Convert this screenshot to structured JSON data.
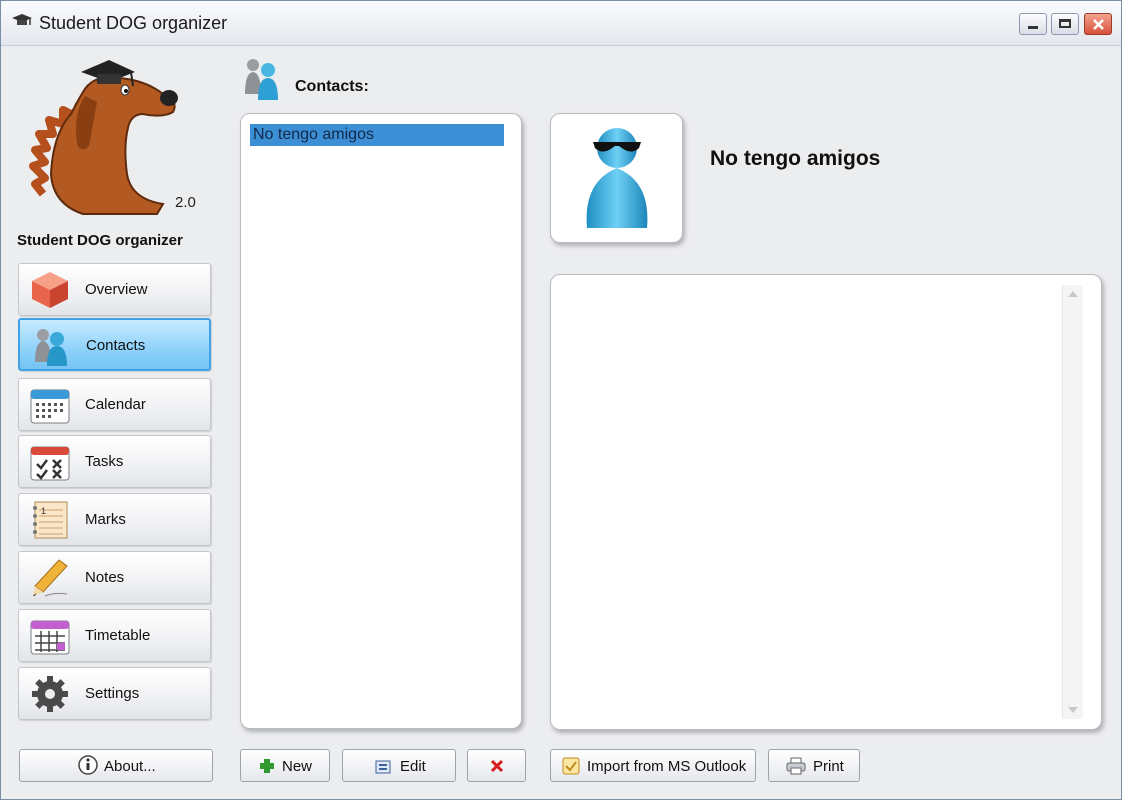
{
  "window": {
    "title": "Student DOG organizer"
  },
  "sidebar": {
    "version": "2.0",
    "app_name": "Student DOG organizer",
    "items": [
      {
        "label": "Overview",
        "icon": "cube-icon"
      },
      {
        "label": "Contacts",
        "icon": "contacts-icon",
        "active": true
      },
      {
        "label": "Calendar",
        "icon": "calendar-icon"
      },
      {
        "label": "Tasks",
        "icon": "tasks-icon"
      },
      {
        "label": "Marks",
        "icon": "marks-notebook-icon"
      },
      {
        "label": "Notes",
        "icon": "pencil-icon"
      },
      {
        "label": "Timetable",
        "icon": "timetable-icon"
      },
      {
        "label": "Settings",
        "icon": "gear-icon"
      }
    ],
    "about_label": "About..."
  },
  "contacts": {
    "header": "Contacts:",
    "list": [
      "No tengo amigos"
    ],
    "selected": "No tengo amigos"
  },
  "detail": {
    "name": "No tengo amigos"
  },
  "toolbar": {
    "new_label": "New",
    "edit_label": "Edit",
    "import_label": "Import from MS Outlook",
    "print_label": "Print"
  },
  "colors": {
    "accent": "#74c4f4",
    "selection": "#3c8fd4",
    "delete": "#d41e1e",
    "add": "#2f9a2f"
  }
}
